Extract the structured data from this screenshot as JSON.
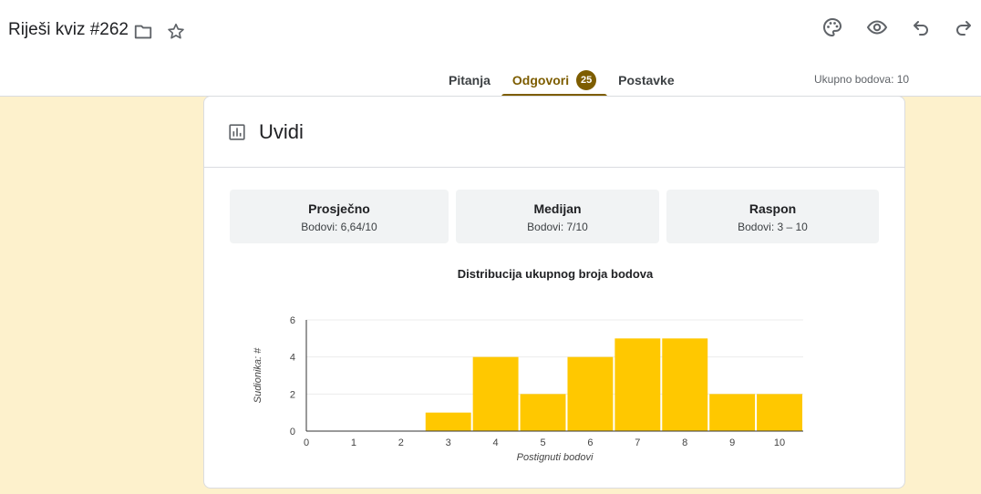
{
  "header": {
    "title": "Riješi kviz #262",
    "icons": [
      "folder-icon",
      "star-icon",
      "palette-icon",
      "eye-icon",
      "undo-icon",
      "redo-icon"
    ]
  },
  "tabs": [
    {
      "label": "Pitanja",
      "active": false
    },
    {
      "label": "Odgovori",
      "active": true,
      "badge": "25"
    },
    {
      "label": "Postavke",
      "active": false
    }
  ],
  "total_points": "Ukupno bodova: 10",
  "colors": {
    "accent": "#7d5d00",
    "bar": "#ffc800",
    "background": "#fdf1cc"
  },
  "insights": {
    "title": "Uvidi",
    "stats": [
      {
        "label": "Prosječno",
        "value": "Bodovi: 6,64/10"
      },
      {
        "label": "Medijan",
        "value": "Bodovi: 7/10"
      },
      {
        "label": "Raspon",
        "value": "Bodovi: 3 – 10"
      }
    ]
  },
  "chart_data": {
    "type": "bar",
    "title": "Distribucija ukupnog broja bodova",
    "xlabel": "Postignuti bodovi",
    "ylabel": "Sudionika: #",
    "x": [
      0,
      1,
      2,
      3,
      4,
      5,
      6,
      7,
      8,
      9,
      10
    ],
    "values": [
      0,
      0,
      0,
      1,
      4,
      2,
      4,
      5,
      5,
      2,
      2
    ],
    "yticks": [
      0,
      2,
      4,
      6
    ],
    "ylim": [
      0,
      6
    ],
    "grid": true
  }
}
